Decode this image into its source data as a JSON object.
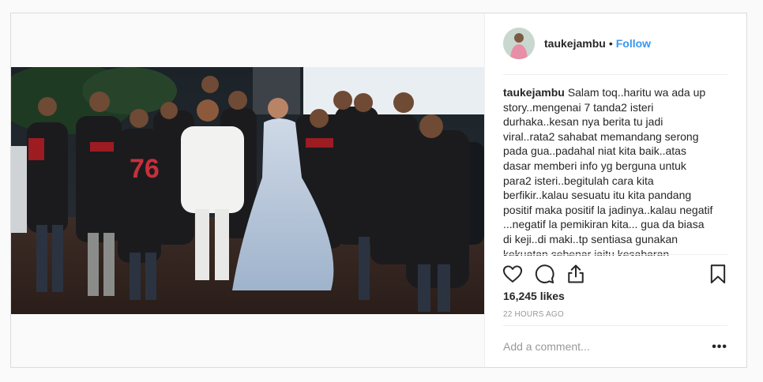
{
  "post": {
    "username": "taukejambu",
    "separator": "•",
    "follow_label": "Follow",
    "caption_username": "taukejambu",
    "caption_text": "Salam toq..haritu wa ada up story..mengenai 7 tanda2 isteri durhaka..kesan nya berita tu jadi viral..rata2 sahabat memandang serong pada gua..padahal niat kita baik..atas dasar memberi info yg berguna untuk para2 isteri..begitulah cara kita berfikir..kalau sesuatu itu kita pandang positif maka positif la jadinya..kalau negatif ...negatif la pemikiran kita... gua da biasa di keji..di maki..tp sentiasa gunakan kekuatan sebenar iaitu kesabaran.. semoga tali ikatan setiap",
    "likes": "16,245 likes",
    "time_ago": "22 HOURS AGO",
    "comment_placeholder": "Add a comment...",
    "more_label": "•••"
  },
  "icons": {
    "like": "heart-icon",
    "comment": "comment-bubble-icon",
    "share": "share-upload-icon",
    "save": "bookmark-icon",
    "options": "more-options-icon"
  },
  "colors": {
    "link_blue": "#3897f0",
    "text": "#262626",
    "muted": "#999999",
    "border": "#dbdbdb"
  }
}
